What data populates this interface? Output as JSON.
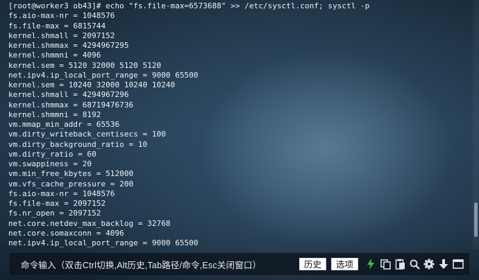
{
  "terminal": {
    "lines": [
      "[root@worker3 ob43]# echo \"fs.file-max=6573688\" >> /etc/sysctl.conf; sysctl -p",
      "fs.aio-max-nr = 1048576",
      "fs.file-max = 6815744",
      "kernel.shmall = 2097152",
      "kernel.shmmax = 4294967295",
      "kernel.shmmni = 4096",
      "kernel.sem = 5120 32000 5120 5120",
      "net.ipv4.ip_local_port_range = 9000 65500",
      "kernel.sem = 10240 32000 10240 10240",
      "kernel.shmall = 4294967296",
      "kernel.shmmax = 68719476736",
      "kernel.shmmni = 8192",
      "vm.mmap_min_addr = 65536",
      "vm.dirty_writeback_centisecs = 100",
      "vm.dirty_background_ratio = 10",
      "vm.dirty_ratio = 60",
      "vm.swappiness = 20",
      "vm.min_free_kbytes = 512000",
      "vm.vfs_cache_pressure = 200",
      "fs.aio-max-nr = 1048576",
      "fs.file-max = 2097152",
      "fs.nr_open = 2097152",
      "net.core.netdev_max_backlog = 32768",
      "net.core.somaxconn = 4096",
      "net.ipv4.ip_local_port_range = 9000 65500"
    ],
    "scroll_position": 0.95
  },
  "command_bar": {
    "hint": "命令输入（双击Ctrl切换,Alt历史,Tab路径/命令,Esc关闭窗口）",
    "history_button": "历史",
    "options_button": "选项",
    "icons": [
      "lightning-icon",
      "copy-icon",
      "paste-icon",
      "search-icon",
      "gear-icon",
      "download-arrow-icon",
      "window-icon"
    ]
  },
  "colors": {
    "terminal_text": "#eef2f5",
    "lightning": "#3ec23e",
    "bar_background": "#0d1620"
  }
}
